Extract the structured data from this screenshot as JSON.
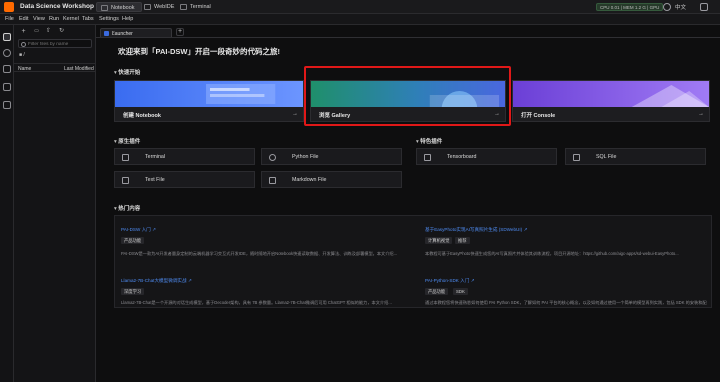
{
  "topbar": {
    "title": "Data Science Workshop",
    "tabs": [
      {
        "label": "Notebook",
        "active": true
      },
      {
        "label": "WebIDE",
        "active": false
      },
      {
        "label": "Terminal",
        "active": false
      }
    ],
    "resource_badge": "CPU 0.01 | MEM 1.2 G | GPU",
    "lang": "中文",
    "icons": [
      "logo-icon",
      "help-icon",
      "user-avatar",
      "language-icon"
    ]
  },
  "menubar": [
    "File",
    "Edit",
    "View",
    "Run",
    "Kernel",
    "Tabs",
    "Settings",
    "Help"
  ],
  "file_panel": {
    "filter_placeholder": "Filter files by name",
    "breadcrumb": "■ /",
    "columns": {
      "name": "Name",
      "modified": "Last Modified"
    }
  },
  "doc_tabs": [
    {
      "label": "Launcher"
    }
  ],
  "launcher": {
    "welcome": "欢迎来到「PAI-DSW」开启一段奇妙的代码之旅!",
    "quickstart": {
      "title": "快速开始",
      "cards": [
        {
          "label": "创建 Notebook",
          "arrow": "→"
        },
        {
          "label": "浏览 Gallery",
          "arrow": "→"
        },
        {
          "label": "打开 Console",
          "arrow": "→"
        }
      ]
    },
    "native": {
      "title": "原生插件",
      "items": [
        "Terminal",
        "Python File",
        "Text File",
        "Markdown File"
      ]
    },
    "special": {
      "title": "特色插件",
      "items": [
        "Tensorboard",
        "SQL File"
      ]
    },
    "hot": {
      "title": "热门内容",
      "items": [
        {
          "link": "PAI-DSW 入门 ↗",
          "tags": [
            "产品功能"
          ],
          "desc": "PAI-DSW是一款为AI开发者量身定制的云端机器学习交互式开发IDE，随时随地开启Notebook快速读取数据、开发算法、训练及部署模型。本文介绍..."
        },
        {
          "link": "基于EasyPhoto实现AI写真照片生成 (SDWebUI) ↗",
          "tags": [
            "计算机视觉",
            "推荐"
          ],
          "desc": "本教程可基于EasyPhoto快速生成您的AI写真照片并体验其训练流程，项目开源地址：https://github.com/aigc-apps/sd-webui-EasyPhoto..."
        },
        {
          "link": "Llama2-7B-Chat大模型微调实战 ↗",
          "tags": [
            "深度学习"
          ],
          "desc": "Llama2-7B-Chat是一个开源的对话生成模型，基于Decoder架构，具有 7B 参数量。Llama2-7B-Chat微调后可用 ChatGPT 相似的能力，本文介绍..."
        },
        {
          "link": "PAI-Python-SDK 入门 ↗",
          "tags": [
            "产品功能",
            "SDK"
          ],
          "desc": "通过本教程您将快速熟悉如何使用 PAI Python SDK，了解如何 PAI 平台的核心概念，以及如何通过使用一个简单的模型再到实践，包括 SDK 的安装和配置..."
        }
      ]
    }
  }
}
